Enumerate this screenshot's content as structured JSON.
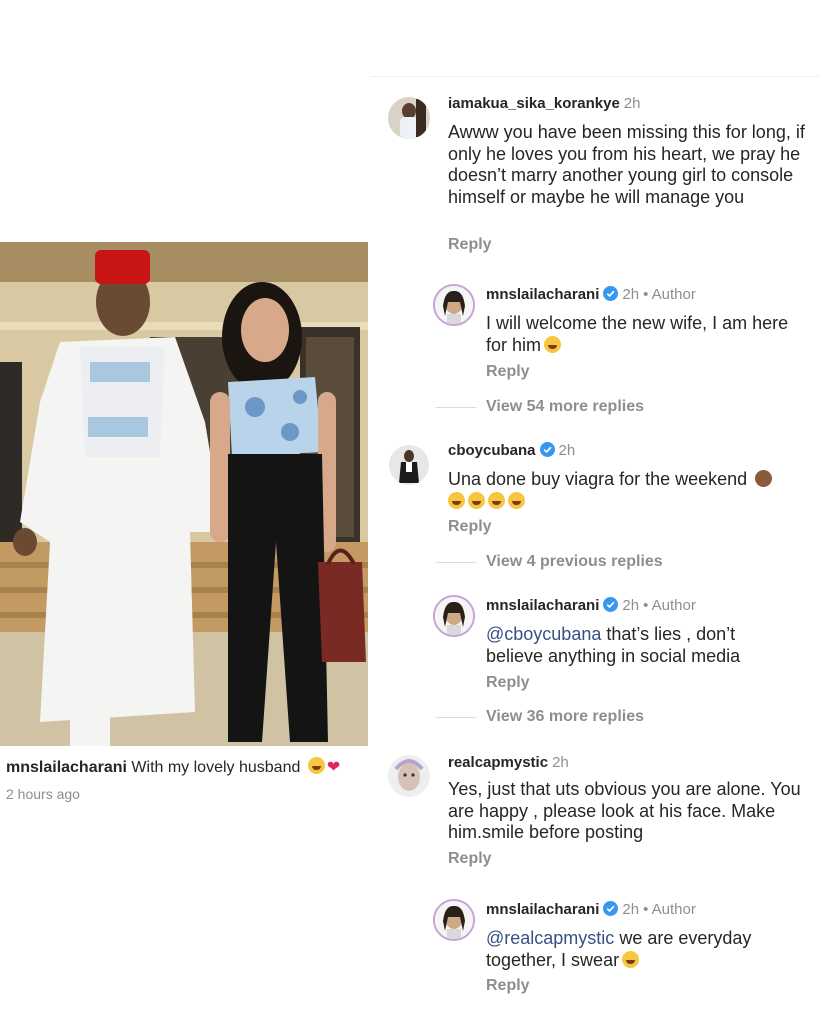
{
  "post": {
    "caption_user": "mnslailacharani",
    "caption_text": "With my lovely husband",
    "time": "2 hours ago"
  },
  "comments": [
    {
      "username": "iamakua_sika_korankye",
      "time": "2h",
      "text": "Awww you have been missing this for long, if only he loves you from his heart, we pray he doesn’t marry another young girl to console himself  or maybe he will manage you",
      "reply_label": "Reply",
      "reply": {
        "username": "mnslailacharani",
        "time": "2h",
        "author_label": "• Author",
        "text": "I will welcome the new wife, I am here for him",
        "reply_label": "Reply"
      },
      "more_replies": "View 54 more replies"
    },
    {
      "username": "cboycubana",
      "time": "2h",
      "text": "Una done buy viagra for the weekend",
      "reply_label": "Reply",
      "previous_replies": "View 4 previous replies",
      "reply": {
        "username": "mnslailacharani",
        "time": "2h",
        "author_label": "• Author",
        "mention": "@cboycubana",
        "text": "that’s lies , don’t believe anything in social media",
        "reply_label": "Reply"
      },
      "more_replies": "View 36 more replies"
    },
    {
      "username": "realcapmystic",
      "time": "2h",
      "text": "Yes, just that uts obvious you are alone. You are happy , please look at his face. Make him.smile before posting",
      "reply_label": "Reply",
      "reply": {
        "username": "mnslailacharani",
        "time": "2h",
        "author_label": "• Author",
        "mention": "@realcapmystic",
        "text": "we are everyday together, I swear",
        "reply_label": "Reply"
      }
    }
  ],
  "colors": {
    "text": "#262626",
    "secondary": "#8e8e8e",
    "mention": "#385185",
    "verified": "#3897f0"
  }
}
